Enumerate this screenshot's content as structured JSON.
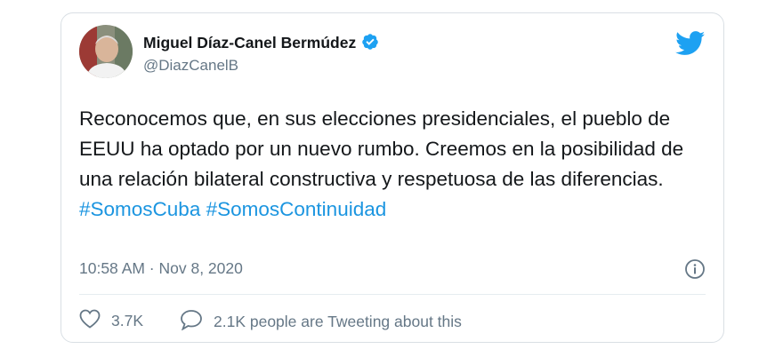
{
  "tweet": {
    "author_name": "Miguel Díaz-Canel Bermúdez",
    "handle": "@DiazCanelB",
    "body_text": "Reconocemos que, en sus elecciones presidenciales, el pueblo de EEUU ha optado por un nuevo rumbo. Creemos en la posibilidad de una relación bilateral constructiva y respetuosa de las diferencias.",
    "hashtag_1": "#SomosCuba",
    "hashtag_2": "#SomosContinuidad",
    "timestamp": "10:58 AM · Nov 8, 2020",
    "likes": "3.7K",
    "conversation": "2.1K people are Tweeting about this"
  },
  "colors": {
    "link": "#1b95e0",
    "twitter_blue": "#1da1f2",
    "secondary_text": "#657786"
  },
  "icons": [
    "verified-icon",
    "twitter-bird-icon",
    "info-icon",
    "heart-icon",
    "speech-bubble-icon"
  ]
}
